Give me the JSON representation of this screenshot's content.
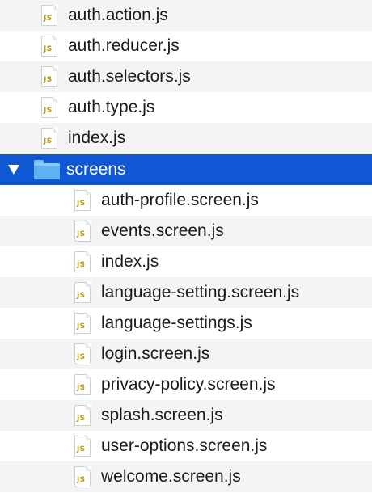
{
  "top_files": [
    {
      "name": "auth.action.js"
    },
    {
      "name": "auth.reducer.js"
    },
    {
      "name": "auth.selectors.js"
    },
    {
      "name": "auth.type.js"
    },
    {
      "name": "index.js"
    }
  ],
  "folder": {
    "name": "screens",
    "expanded": true,
    "selected": true,
    "icon": "folder-icon",
    "color": "#5eb3f5"
  },
  "folder_files": [
    {
      "name": "auth-profile.screen.js"
    },
    {
      "name": "events.screen.js"
    },
    {
      "name": "index.js"
    },
    {
      "name": "language-setting.screen.js"
    },
    {
      "name": "language-settings.js"
    },
    {
      "name": "login.screen.js"
    },
    {
      "name": "privacy-policy.screen.js"
    },
    {
      "name": "splash.screen.js"
    },
    {
      "name": "user-options.screen.js"
    },
    {
      "name": "welcome.screen.js"
    }
  ],
  "file_icon_text": "JS",
  "colors": {
    "selection": "#1057d3",
    "js_badge": "#b59a15",
    "alt_row": "#f4f4f4"
  }
}
